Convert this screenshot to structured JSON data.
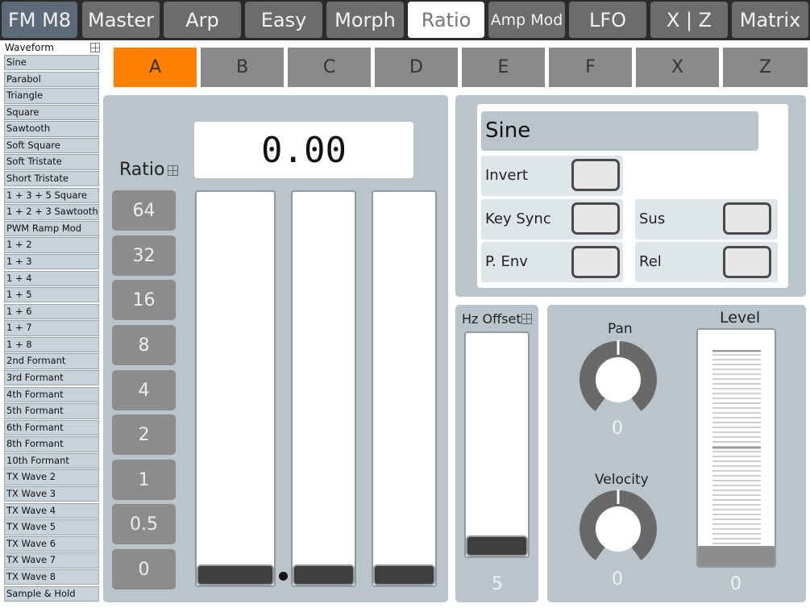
{
  "top_tabs": [
    {
      "label": "FM M8"
    },
    {
      "label": "Master"
    },
    {
      "label": "Arp"
    },
    {
      "label": "Easy"
    },
    {
      "label": "Morph"
    },
    {
      "label": "Ratio"
    },
    {
      "label": "Amp Mod"
    },
    {
      "label": "LFO"
    },
    {
      "label": "X | Z"
    },
    {
      "label": "Matrix"
    }
  ],
  "waveform": {
    "header": "Waveform",
    "items": [
      "Sine",
      "Parabol",
      "Triangle",
      "Square",
      "Sawtooth",
      "Soft Square",
      "Soft Tristate",
      "Short Tristate",
      "1 + 3 + 5 Square",
      "1 + 2 + 3 Sawtooth",
      "PWM Ramp Mod",
      "1  +  2",
      "1  +  3",
      "1  +  4",
      "1  +  5",
      "1  +  6",
      "1  +  7",
      "1  +  8",
      "2nd Formant",
      "3rd Formant",
      "4th Formant",
      "5th Formant",
      "6th Formant",
      "8th Formant",
      "10th Formant",
      "TX Wave 2",
      "TX Wave 3",
      "TX Wave 4",
      "TX Wave 5",
      "TX Wave 6",
      "TX Wave 7",
      "TX Wave 8",
      "Sample & Hold"
    ]
  },
  "operators": [
    "A",
    "B",
    "C",
    "D",
    "E",
    "F",
    "X",
    "Z"
  ],
  "ratio": {
    "label": "Ratio",
    "buttons": [
      "64",
      "32",
      "16",
      "8",
      "4",
      "2",
      "1",
      "0.5",
      "0"
    ],
    "display": "0.00"
  },
  "wave_settings": {
    "selected": "Sine",
    "invert": "Invert",
    "key_sync": "Key Sync",
    "p_env": "P. Env",
    "sus": "Sus",
    "rel": "Rel"
  },
  "hz_offset": {
    "label": "Hz Offset",
    "value": "5"
  },
  "pan": {
    "label": "Pan",
    "value": "0"
  },
  "velocity": {
    "label": "Velocity",
    "value": "0"
  },
  "level": {
    "label": "Level",
    "value": "0"
  },
  "colors": {
    "accent": "#ff8000",
    "panel": "#b9c5cb",
    "tab": "#6c6c6c"
  }
}
